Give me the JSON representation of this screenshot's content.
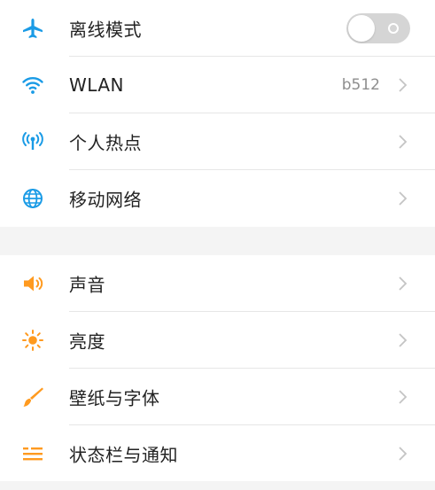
{
  "colors": {
    "blue_icon": "#1a9be6",
    "orange_icon": "#ff9a1f",
    "text": "#222222",
    "secondary": "#8e8e8e",
    "toggle_off": "#d5d5d5"
  },
  "network": {
    "airplane": {
      "label": "离线模式",
      "icon": "airplane-icon",
      "toggle_on": false
    },
    "wlan": {
      "label": "WLAN",
      "value": "b512",
      "icon": "wifi-icon"
    },
    "hotspot": {
      "label": "个人热点",
      "icon": "hotspot-icon"
    },
    "mobile": {
      "label": "移动网络",
      "icon": "globe-icon"
    }
  },
  "display": {
    "sound": {
      "label": "声音",
      "icon": "speaker-icon"
    },
    "brightness": {
      "label": "亮度",
      "icon": "sun-icon"
    },
    "wallpaper": {
      "label": "壁纸与字体",
      "icon": "brush-icon"
    },
    "statusbar": {
      "label": "状态栏与通知",
      "icon": "notification-list-icon"
    }
  }
}
